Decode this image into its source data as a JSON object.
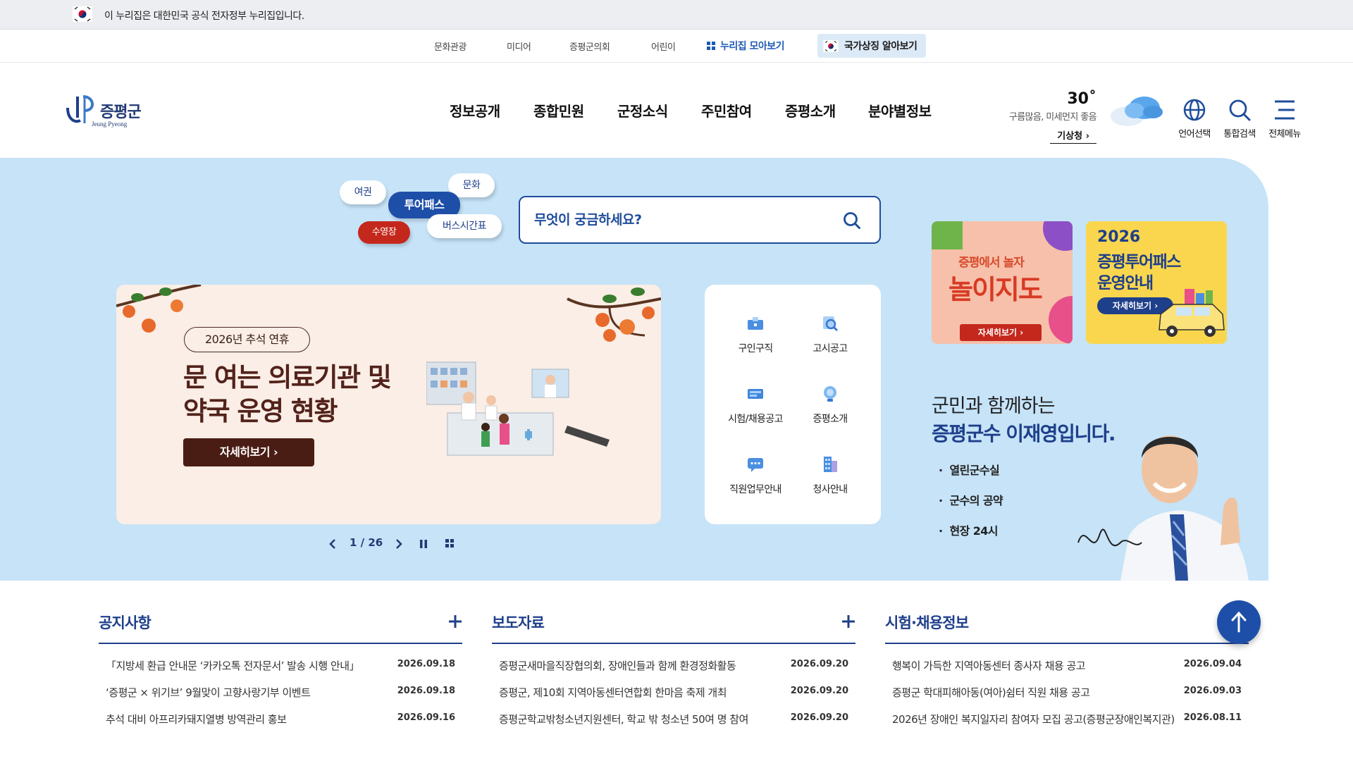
{
  "gov_banner": {
    "text": "이 누리집은 대한민국 공식 전자정부 누리집입니다."
  },
  "utility": {
    "links": [
      "문화관광",
      "미디어",
      "증평군의회",
      "어린이"
    ],
    "nuri_label": "누리집 모아보기",
    "symbol_label": "국가상징 알아보기"
  },
  "header": {
    "logo_text": "증평군",
    "logo_sub": "Jeung Pyeong",
    "gnb": [
      "정보공개",
      "종합민원",
      "군정소식",
      "주민참여",
      "증평소개",
      "분야별정보"
    ],
    "weather": {
      "temp": "30˚",
      "desc": "구름많음, 미세먼지 좋음",
      "source": "기상청 ›"
    },
    "buttons": {
      "language": "언어선택",
      "search": "통합검색",
      "menu": "전체메뉴"
    }
  },
  "hero": {
    "tags": [
      "여권",
      "문화",
      "투어패스",
      "버스시간표",
      "수영장"
    ],
    "search_placeholder": "무엇이 궁금하세요?",
    "slide": {
      "pill": "2026년 추석 연휴",
      "title_line1": "문 여는 의료기관 및",
      "title_line2": "약국 운영 현황",
      "more": "자세히보기  ›",
      "current": "1",
      "total": "26"
    },
    "quick_menu": [
      "구인구직",
      "고시공고",
      "시험/채용공고",
      "증평소개",
      "직원업무안내",
      "청사안내"
    ],
    "banner1": {
      "line1": "증평에서 놀자",
      "line2": "놀이지도",
      "btn": "자세히보기 ›"
    },
    "banner2": {
      "line1": "2026",
      "line2": "증평투어패스",
      "line3": "운영안내",
      "btn": "자세히보기 ›"
    },
    "mayor": {
      "line1": "군민과 함께하는",
      "line2": "증평군수 이재영입니다.",
      "links": [
        "열린군수실",
        "군수의 공약",
        "현장 24시"
      ]
    }
  },
  "boards": [
    {
      "title": "공지사항",
      "items": [
        {
          "title": "「지방세 환급 안내문 ‘카카오톡 전자문서’ 발송 시행 안내」",
          "date": "2026.09.18"
        },
        {
          "title": "‘증평군 × 위기브’ 9월맞이 고향사랑기부 이벤트",
          "date": "2026.09.18"
        },
        {
          "title": "추석 대비 아프리카돼지열병 방역관리 홍보",
          "date": "2026.09.16"
        }
      ]
    },
    {
      "title": "보도자료",
      "items": [
        {
          "title": "증평군새마을직장협의회, 장애인들과 함께 환경정화활동",
          "date": "2026.09.20"
        },
        {
          "title": "증평군, 제10회 지역아동센터연합회 한마음 축제 개최",
          "date": "2026.09.20"
        },
        {
          "title": "증평군학교밖청소년지원센터, 학교 밖 청소년 50여 명 참여",
          "date": "2026.09.20"
        }
      ]
    },
    {
      "title": "시험·채용정보",
      "items": [
        {
          "title": "행복이 가득한 지역아동센터 종사자 채용 공고",
          "date": "2026.09.04"
        },
        {
          "title": "증평군 학대피해아동(여아)쉼터 직원 채용 공고",
          "date": "2026.09.03"
        },
        {
          "title": "2026년 장애인 복지일자리 참여자 모집 공고(증평군장애인복지관)",
          "date": "2026.08.11"
        }
      ]
    }
  ],
  "colors": {
    "primary": "#1e4d9b",
    "hero_bg": "#c6e3f8",
    "gov_bar": "#eceef1",
    "slide_title": "#52221a"
  }
}
